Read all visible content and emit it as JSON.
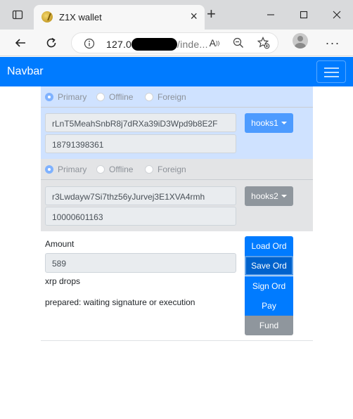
{
  "browser": {
    "tab_title": "Z1X wallet",
    "url_prefix": "127.0",
    "url_suffix": "/inde..."
  },
  "navbar": {
    "brand": "Navbar"
  },
  "accounts": [
    {
      "radio_options": [
        "Primary",
        "Offline",
        "Foreign"
      ],
      "selected": "Primary",
      "address": "rLnT5MeahSnbR8j7dRXa39iD3Wpd9b8E2F",
      "number": "18791398361",
      "dropdown_label": "hooks1"
    },
    {
      "radio_options": [
        "Primary",
        "Offline",
        "Foreign"
      ],
      "selected": "Primary",
      "address": "r3Lwdayw7Si7thz56yJurvej3E1XVA4rmh",
      "number": "10000601163",
      "dropdown_label": "hooks2"
    }
  ],
  "amount": {
    "label": "Amount",
    "value": "589",
    "unit": "xrp drops"
  },
  "status": "prepared: waiting signature or execution",
  "actions": [
    "Load Ord",
    "Save Ord",
    "Sign Ord",
    "Pay",
    "Fund"
  ],
  "colors": {
    "navbar": "#007bff",
    "account1_bg": "#cfe2ff",
    "account2_bg": "#e3e4e6",
    "primary_button": "#007bff",
    "secondary_button": "#8f969d"
  }
}
